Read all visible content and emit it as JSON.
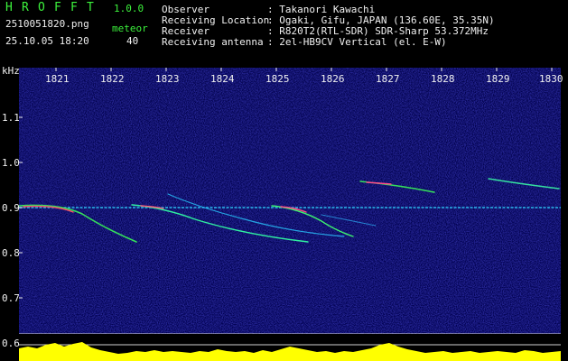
{
  "header": {
    "app_letters": [
      "H",
      "R",
      "O",
      "F",
      "F",
      "T"
    ],
    "version": "1.0.0",
    "filename": "2510051820.png",
    "datetime": "25.10.05 18:20",
    "meteor_label": "meteor",
    "meteor_count": "40"
  },
  "info": {
    "observer_label": "Observer",
    "observer_value": ": Takanori Kawachi",
    "location_label": "Receiving Location",
    "location_value": ": Ogaki, Gifu, JAPAN (136.60E, 35.35N)",
    "receiver_label": "Receiver",
    "receiver_value": ": R820T2(RTL-SDR) SDR-Sharp 53.372MHz",
    "antenna_label": "Receiving antenna",
    "antenna_value": ": 2el-HB9CV Vertical (el. E-W)"
  },
  "axis": {
    "unit": "kHz",
    "y_ticks": [
      "1.1",
      "1.0",
      "0.9",
      "0.8",
      "0.7",
      "0.62"
    ],
    "x_ticks": [
      "1821",
      "1822",
      "1823",
      "1824",
      "1825",
      "1826",
      "1827",
      "1828",
      "1829",
      "1830"
    ]
  },
  "colors": {
    "label_green": "#3cf23c",
    "text_white": "#f0f0f0",
    "background": "#00003a",
    "level_yellow": "#ffff00",
    "level_cyan": "#00d8ff"
  }
}
